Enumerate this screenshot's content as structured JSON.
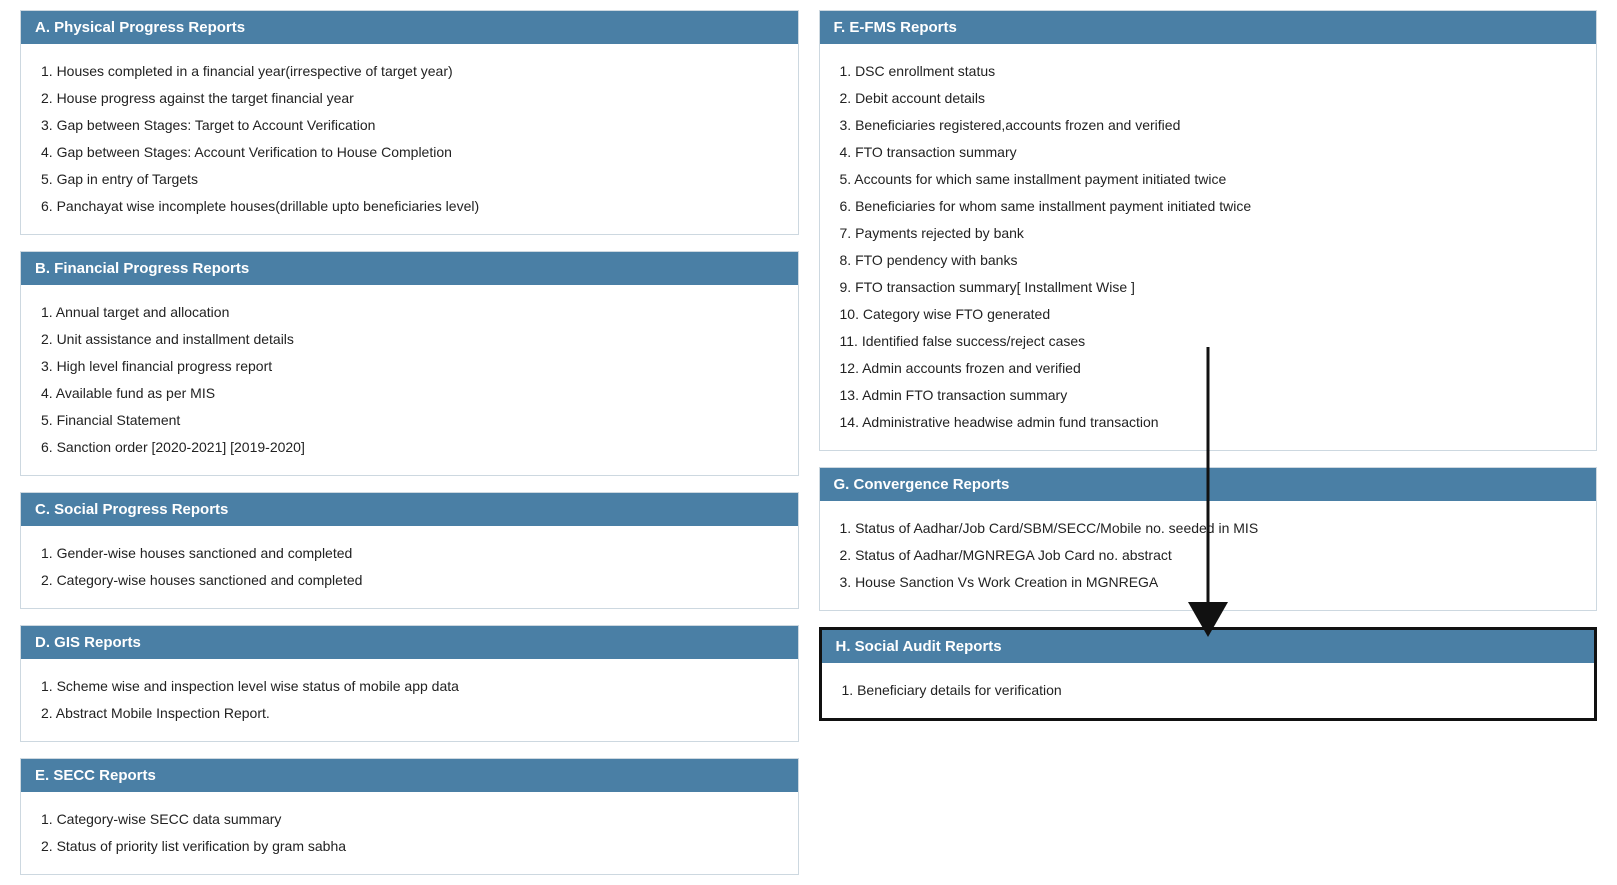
{
  "sections": {
    "A": {
      "header": "A. Physical Progress Reports",
      "items": [
        "1. Houses completed in a financial year(irrespective of target year)",
        "2. House progress against the target financial year",
        "3. Gap between Stages: Target to Account Verification",
        "4. Gap between Stages: Account Verification to House Completion",
        "5. Gap in entry of Targets",
        "6. Panchayat wise incomplete houses(drillable upto beneficiaries level)"
      ]
    },
    "B": {
      "header": "B. Financial Progress Reports",
      "items": [
        "1. Annual target and allocation",
        "2. Unit assistance and installment details",
        "3. High level financial progress report",
        "4. Available fund as per MIS",
        "5. Financial Statement",
        "6. Sanction order [2020-2021] [2019-2020]"
      ]
    },
    "C": {
      "header": "C. Social Progress Reports",
      "items": [
        "1. Gender-wise houses sanctioned and completed",
        "2. Category-wise houses sanctioned and completed"
      ]
    },
    "D": {
      "header": "D. GIS Reports",
      "items": [
        "1. Scheme wise and inspection level wise status of mobile app data",
        "2. Abstract Mobile Inspection Report."
      ]
    },
    "E": {
      "header": "E. SECC Reports",
      "items": [
        "1. Category-wise SECC data summary",
        "2. Status of priority list verification by gram sabha"
      ]
    },
    "F": {
      "header": "F. E-FMS Reports",
      "items": [
        "1. DSC enrollment status",
        "2. Debit account details",
        "3. Beneficiaries registered,accounts frozen and verified",
        "4. FTO transaction summary",
        "5. Accounts for which same installment payment initiated twice",
        "6. Beneficiaries for whom same installment payment initiated twice",
        "7. Payments rejected by bank",
        "8. FTO pendency with banks",
        "9. FTO transaction summary[ Installment Wise ]",
        "10. Category wise FTO generated",
        "11. Identified false success/reject cases",
        "12. Admin accounts frozen and verified",
        "13. Admin FTO transaction summary",
        "14. Administrative headwise admin fund transaction"
      ]
    },
    "G": {
      "header": "G. Convergence Reports",
      "items": [
        "1. Status of Aadhar/Job Card/SBM/SECC/Mobile no. seeded in MIS",
        "2. Status of Aadhar/MGNREGA Job Card no. abstract",
        "3. House Sanction Vs Work Creation in MGNREGA"
      ]
    },
    "H": {
      "header": "H. Social Audit Reports",
      "items": [
        "1. Beneficiary details for verification"
      ]
    }
  }
}
